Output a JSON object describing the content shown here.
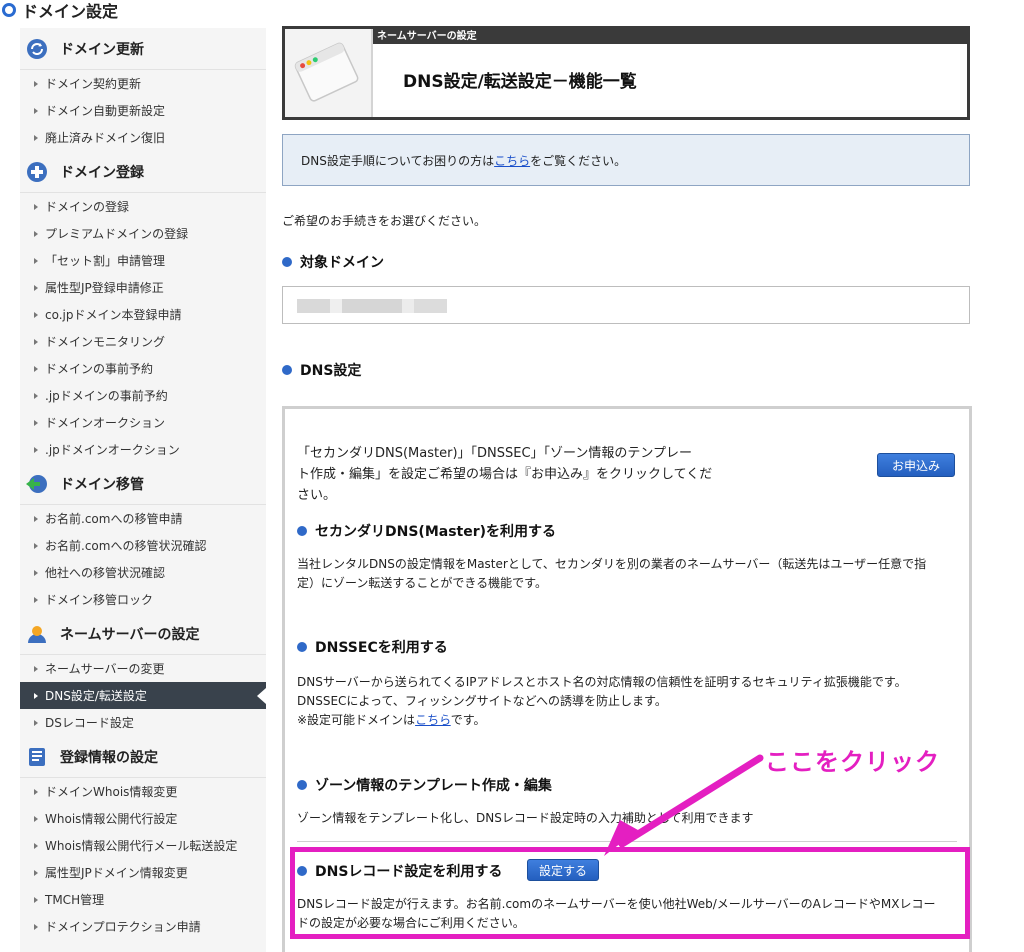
{
  "page": {
    "title": "ドメイン設定"
  },
  "sidebar": {
    "sections": [
      {
        "title": "ドメイン更新",
        "icon": "renew-arrows-icon",
        "items": [
          "ドメイン契約更新",
          "ドメイン自動更新設定",
          "廃止済みドメイン復旧"
        ]
      },
      {
        "title": "ドメイン登録",
        "icon": "plus-circle-icon",
        "items": [
          "ドメインの登録",
          "プレミアムドメインの登録",
          "「セット割」申請管理",
          "属性型JP登録申請修正",
          "co.jpドメイン本登録申請",
          "ドメインモニタリング",
          "ドメインの事前予約",
          ".jpドメインの事前予約",
          "ドメインオークション",
          ".jpドメインオークション"
        ]
      },
      {
        "title": "ドメイン移管",
        "icon": "transfer-globe-icon",
        "items": [
          "お名前.comへの移管申請",
          "お名前.comへの移管状況確認",
          "他社への移管状況確認",
          "ドメイン移管ロック"
        ]
      },
      {
        "title": "ネームサーバーの設定",
        "icon": "person-server-icon",
        "items": [
          "ネームサーバーの変更",
          "DNS設定/転送設定",
          "DSレコード設定"
        ]
      },
      {
        "title": "登録情報の設定",
        "icon": "registry-book-icon",
        "items": [
          "ドメインWhois情報変更",
          "Whois情報公開代行設定",
          "Whois情報公開代行メール転送設定",
          "属性型JPドメイン情報変更",
          "TMCH管理",
          "ドメインプロテクション申請"
        ]
      }
    ],
    "active_item": "DNS設定/転送設定"
  },
  "header_box": {
    "tab_label": "ネームサーバーの設定",
    "title": "DNS設定/転送設定－機能一覧"
  },
  "info": {
    "before": "DNS設定手順についてお困りの方は",
    "link": "こちら",
    "after": "をご覧ください。"
  },
  "instruction": "ご希望のお手続きをお選びください。",
  "target_domain": {
    "heading": "対象ドメイン",
    "value": ""
  },
  "dns": {
    "heading": "DNS設定",
    "intro_lines": [
      "「セカンダリDNS(Master)」「DNSSEC」「ゾーン情報のテンプレー",
      "ト作成・編集」を設定ご希望の場合は『お申込み』をクリックしてくだ",
      "さい。"
    ],
    "apply_button": "お申込み",
    "secondary": {
      "title": "セカンダリDNS(Master)を利用する",
      "lines": [
        "当社レンタルDNSの設定情報をMasterとして、セカンダリを別の業者のネームサーバー（転送先はユーザー任意で指",
        "定）にゾーン転送することができる機能です。"
      ]
    },
    "dnssec": {
      "title": "DNSSECを利用する",
      "lines": [
        "DNSサーバーから送られてくるIPアドレスとホスト名の対応情報の信頼性を証明するセキュリティ拡張機能です。",
        "DNSSECによって、フィッシングサイトなどへの誘導を防止します。"
      ],
      "note_before": "※設定可能ドメインは",
      "note_link": "こちら",
      "note_after": "です。"
    },
    "zone": {
      "title": "ゾーン情報のテンプレート作成・編集",
      "line": "ゾーン情報をテンプレート化し、DNSレコード設定時の入力補助として利用できます"
    },
    "record": {
      "title": "DNSレコード設定を利用する",
      "button": "設定する",
      "lines": [
        "DNSレコード設定が行えます。お名前.comのネームサーバーを使い他社Web/メールサーバーのAレコードやMXレコー",
        "ドの設定が必要な場合にご利用ください。"
      ]
    }
  },
  "annotation": {
    "callout": "ここをクリック",
    "color": "#e41fc1"
  }
}
